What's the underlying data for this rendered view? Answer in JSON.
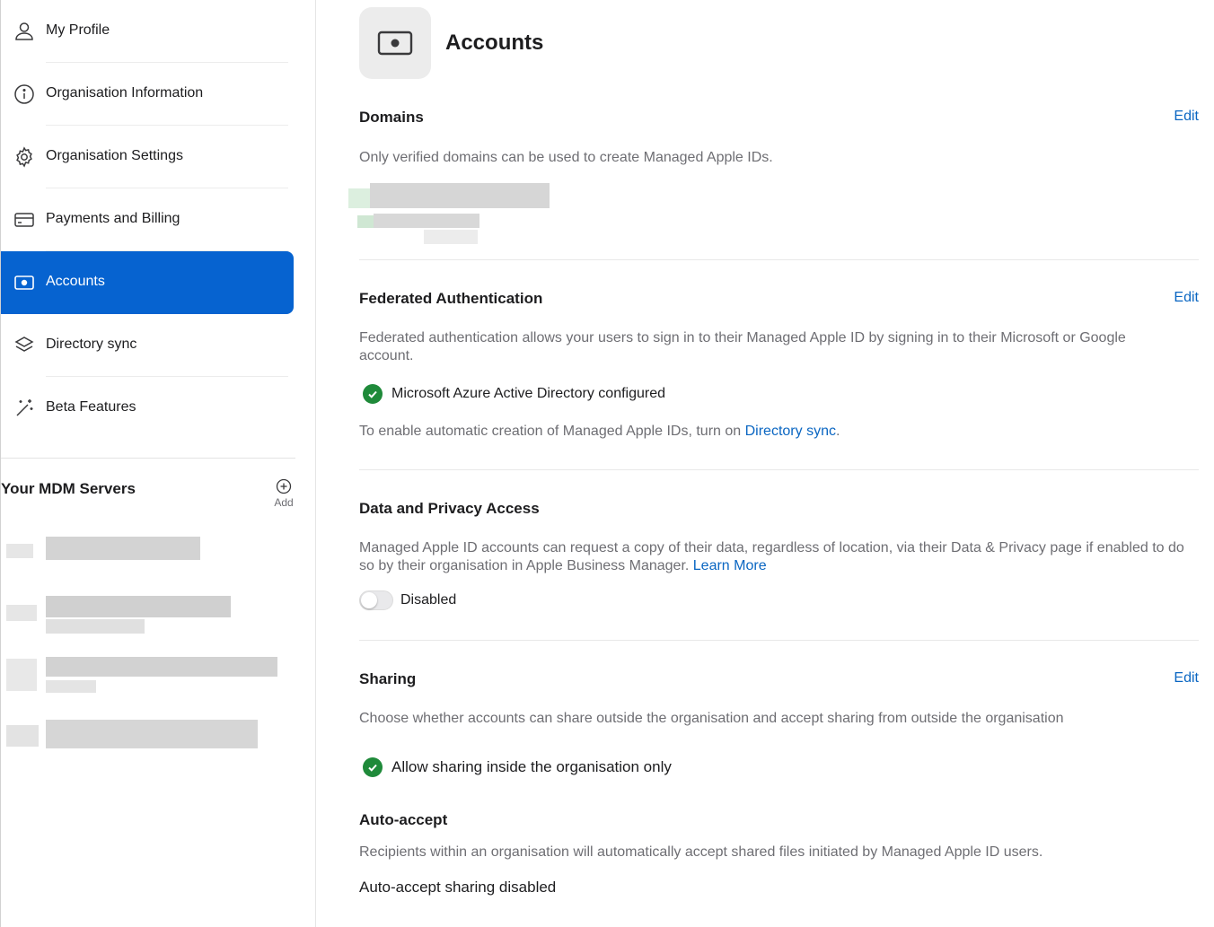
{
  "sidebar": {
    "items": [
      {
        "label": "My Profile",
        "icon": "person-icon"
      },
      {
        "label": "Organisation Information",
        "icon": "info-icon"
      },
      {
        "label": "Organisation Settings",
        "icon": "gear-icon"
      },
      {
        "label": "Payments and Billing",
        "icon": "credit-card-icon"
      },
      {
        "label": "Accounts",
        "icon": "apple-account-icon",
        "active": true
      },
      {
        "label": "Directory sync",
        "icon": "layers-icon"
      },
      {
        "label": "Beta Features",
        "icon": "sparkle-icon"
      }
    ],
    "mdm": {
      "title": "Your MDM Servers",
      "add_label": "Add"
    }
  },
  "main": {
    "title": "Accounts",
    "domains": {
      "title": "Domains",
      "edit": "Edit",
      "description": "Only verified domains can be used to create Managed Apple IDs."
    },
    "federated": {
      "title": "Federated Authentication",
      "edit": "Edit",
      "description": "Federated authentication allows your users to sign in to their Managed Apple ID by signing in to their Microsoft or Google account.",
      "status": "Microsoft Azure Active Directory configured",
      "note_prefix": "To enable automatic creation of Managed Apple IDs, turn on ",
      "note_link": "Directory sync",
      "note_suffix": "."
    },
    "privacy": {
      "title": "Data and Privacy Access",
      "description": "Managed Apple ID accounts can request a copy of their data, regardless of location, via their Data & Privacy page if enabled to do so by their organisation in Apple Business Manager. ",
      "learn_more": "Learn More",
      "toggle_label": "Disabled"
    },
    "sharing": {
      "title": "Sharing",
      "edit": "Edit",
      "description": "Choose whether accounts can share outside the organisation and accept sharing from outside the organisation",
      "status": "Allow sharing inside the organisation only",
      "auto_accept_title": "Auto-accept",
      "auto_accept_description": "Recipients within an organisation will automatically accept shared files initiated by Managed Apple ID users.",
      "auto_accept_status": "Auto-accept sharing disabled"
    }
  },
  "colors": {
    "accent": "#0663d0",
    "link": "#0a66c2",
    "success": "#1f8a3a"
  }
}
